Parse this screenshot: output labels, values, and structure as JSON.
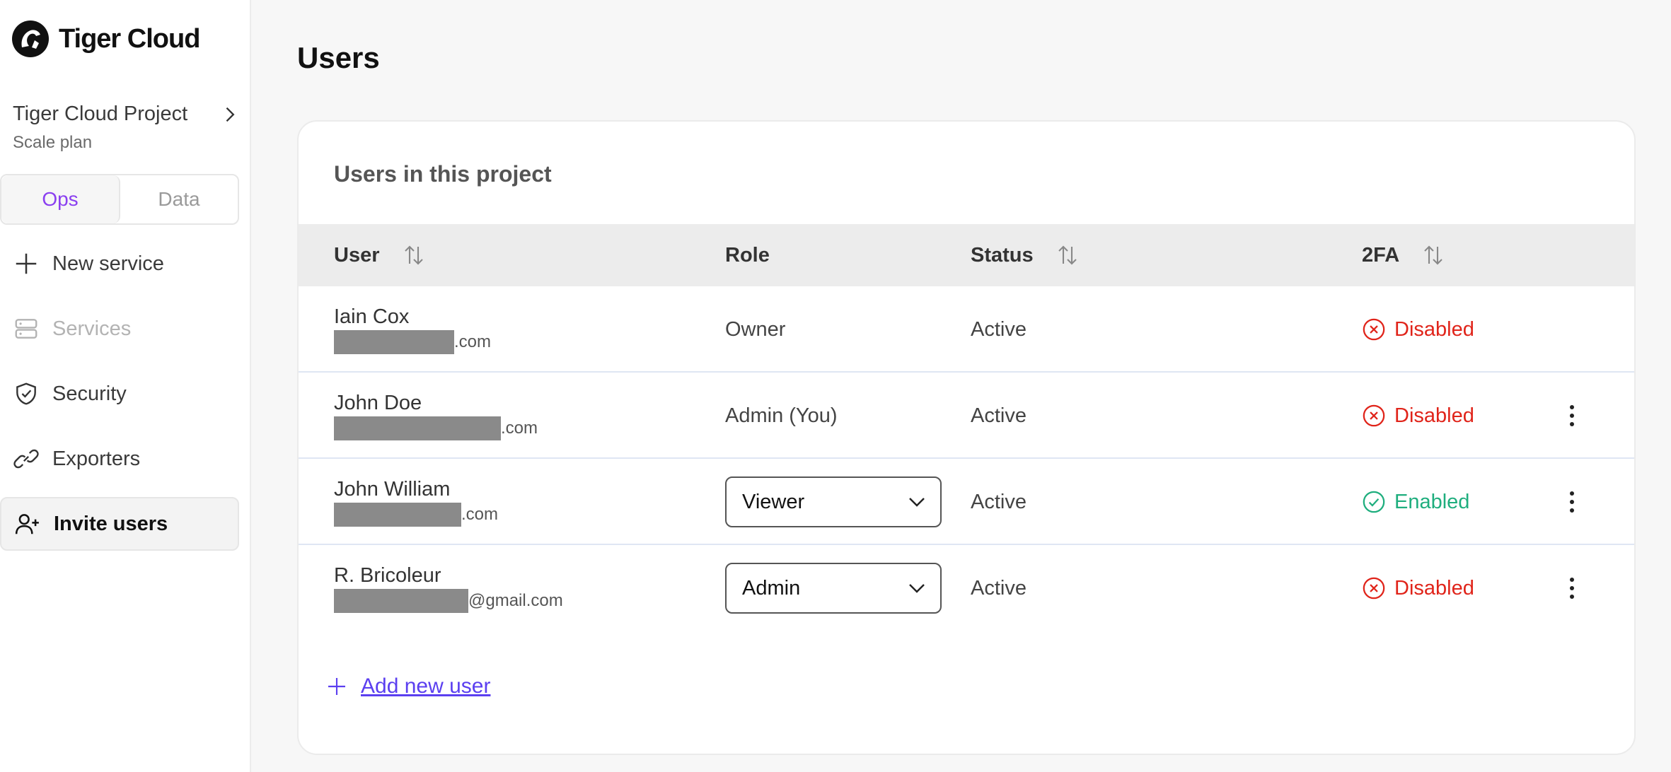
{
  "brand": {
    "name": "Tiger Cloud"
  },
  "project": {
    "name": "Tiger Cloud Project",
    "plan": "Scale plan"
  },
  "tabs": [
    {
      "label": "Ops",
      "active": true
    },
    {
      "label": "Data",
      "active": false
    }
  ],
  "nav": {
    "items": [
      {
        "label": "New service",
        "icon": "plus-icon"
      },
      {
        "label": "Services",
        "icon": "server-icon",
        "disabled": true
      },
      {
        "label": "Security",
        "icon": "shield-check-icon"
      },
      {
        "label": "Exporters",
        "icon": "link-icon"
      },
      {
        "label": "Invite users",
        "icon": "user-plus-icon",
        "active": true
      }
    ]
  },
  "page": {
    "title": "Users"
  },
  "table": {
    "title": "Users in this project",
    "columns": [
      "User",
      "Role",
      "Status",
      "2FA"
    ],
    "rows": [
      {
        "name": "Iain Cox",
        "email_suffix": ".com",
        "role": "Owner",
        "role_editable": false,
        "status": "Active",
        "twofa": "Disabled"
      },
      {
        "name": "John Doe",
        "email_suffix": ".com",
        "role": "Admin (You)",
        "role_editable": false,
        "status": "Active",
        "twofa": "Disabled"
      },
      {
        "name": "John William",
        "email_suffix": ".com",
        "role": "Viewer",
        "role_editable": true,
        "status": "Active",
        "twofa": "Enabled"
      },
      {
        "name": "R. Bricoleur",
        "email_suffix": "@gmail.com",
        "role": "Admin",
        "role_editable": true,
        "status": "Active",
        "twofa": "Disabled"
      }
    ]
  },
  "actions": {
    "add_user": "Add new user"
  },
  "colors": {
    "accent": "#8a3ff0",
    "link": "#5b3ff0",
    "danger": "#e0241a",
    "success": "#1fae7e"
  }
}
